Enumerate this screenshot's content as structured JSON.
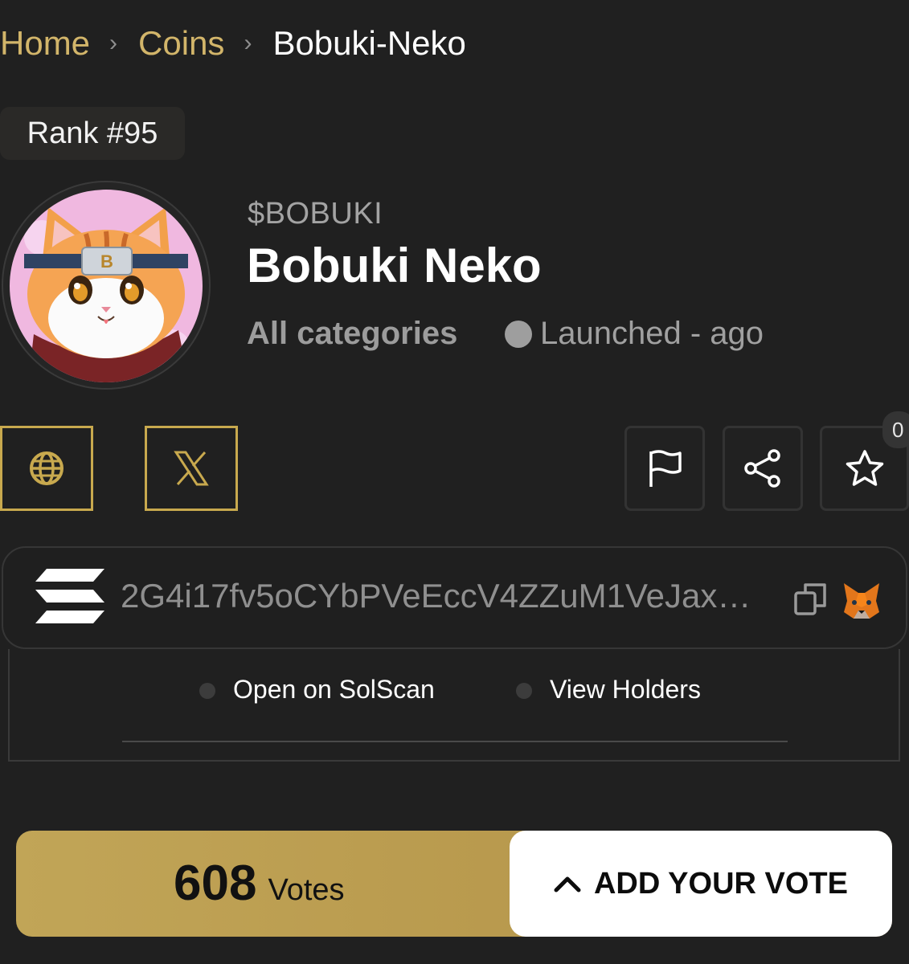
{
  "breadcrumb": {
    "home": "Home",
    "coins": "Coins",
    "current": "Bobuki-Neko"
  },
  "rank": "Rank #95",
  "token": {
    "ticker": "$BOBUKI",
    "name": "Bobuki Neko",
    "category": "All categories",
    "launched": "Launched - ago"
  },
  "actions": {
    "favorite_count": "0"
  },
  "contract": {
    "address": "2G4i17fv5oCYbPVeEccV4ZZuM1VeJax…"
  },
  "links": {
    "solscan": "Open on SolScan",
    "holders": "View Holders"
  },
  "votes": {
    "count": "608",
    "label": "Votes",
    "add_label": "ADD YOUR VOTE"
  },
  "colors": {
    "accent_gold": "#c8a94e",
    "background": "#202020"
  }
}
